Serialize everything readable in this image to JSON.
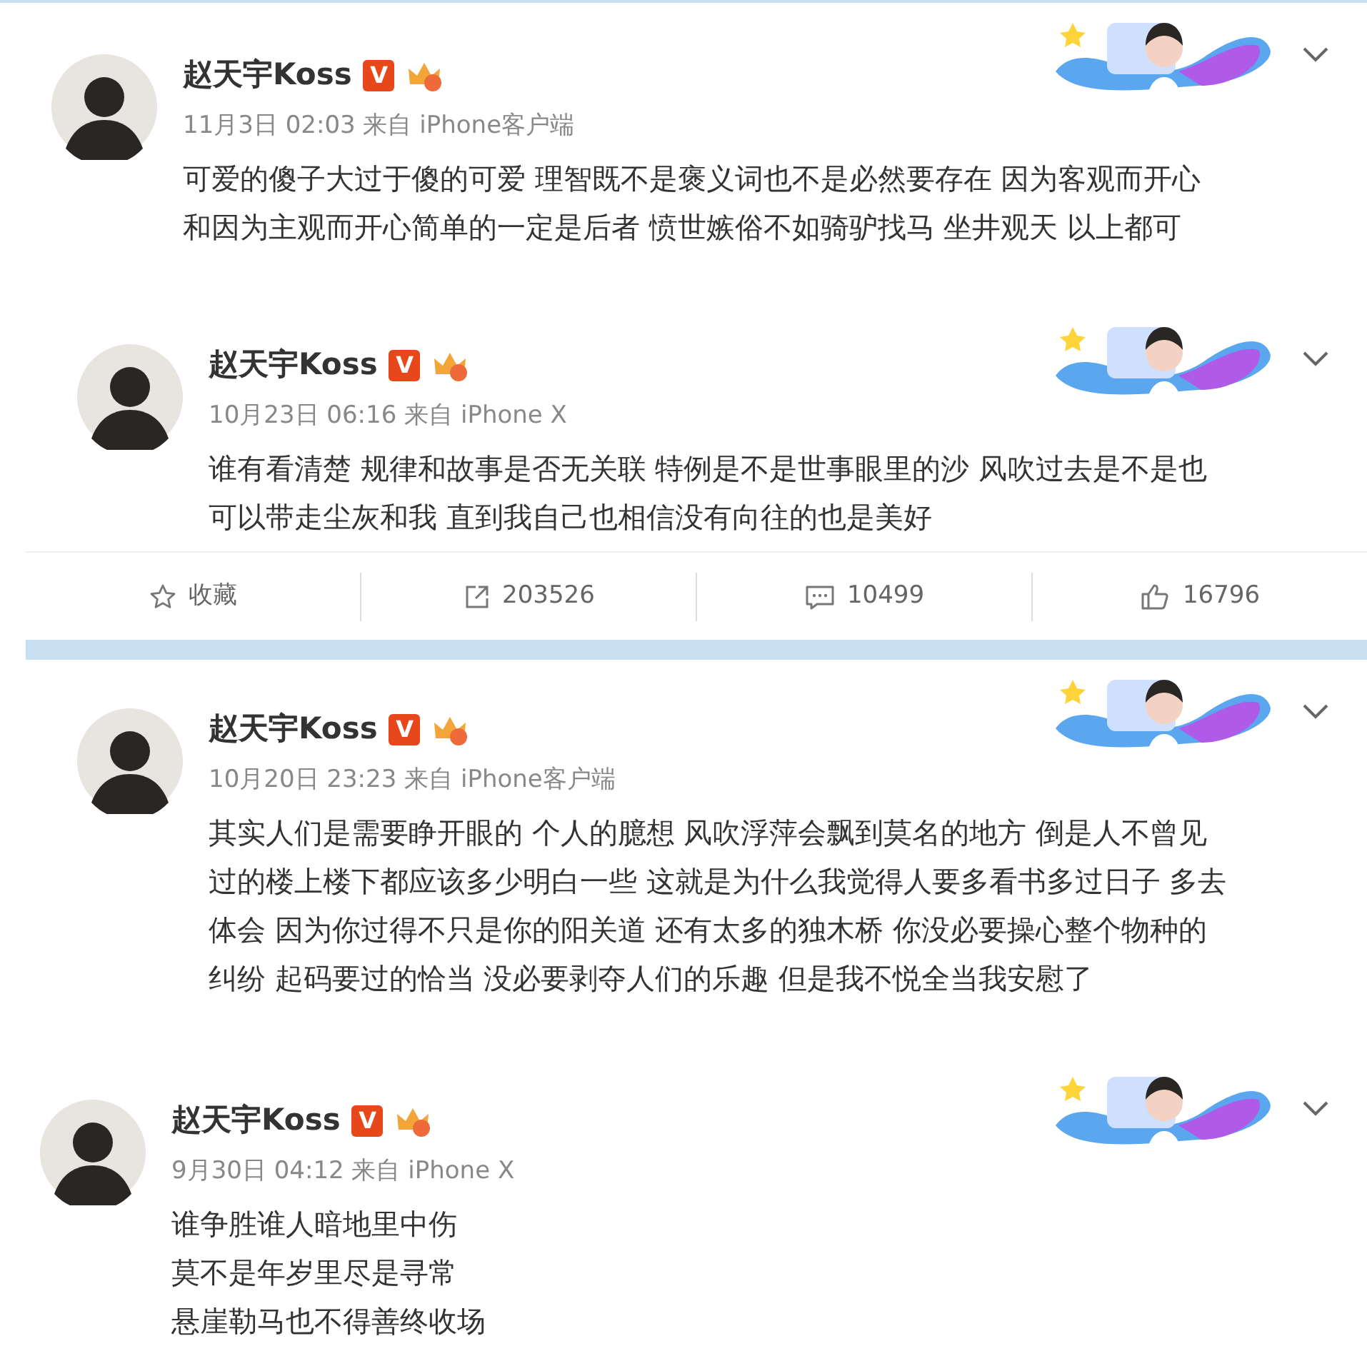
{
  "posts": [
    {
      "author": "赵天宇Koss",
      "verified_mark": "V",
      "meta": "11月3日 02:03 来自 iPhone客户端",
      "lines": [
        "可爱的傻子大过于傻的可爱 理智既不是褒义词也不是必然要存在 因为客观而开心",
        "和因为主观而开心简单的一定是后者 愤世嫉俗不如骑驴找马 坐井观天 以上都可"
      ]
    },
    {
      "author": "赵天宇Koss",
      "verified_mark": "V",
      "meta": "10月23日 06:16 来自 iPhone X",
      "lines": [
        "谁有看清楚 规律和故事是否无关联 特例是不是世事眼里的沙 风吹过去是不是也",
        "可以带走尘灰和我 直到我自己也相信没有向往的也是美好"
      ],
      "actions": [
        {
          "kind": "favorite",
          "label": "收藏"
        },
        {
          "kind": "repost",
          "label": "203526"
        },
        {
          "kind": "comment",
          "label": "10499"
        },
        {
          "kind": "like",
          "label": "16796"
        }
      ]
    },
    {
      "author": "赵天宇Koss",
      "verified_mark": "V",
      "meta": "10月20日 23:23 来自 iPhone客户端",
      "lines": [
        "其实人们是需要睁开眼的 个人的臆想 风吹浮萍会飘到莫名的地方 倒是人不曾见",
        "过的楼上楼下都应该多少明白一些 这就是为什么我觉得人要多看书多过日子 多去",
        "体会 因为你过得不只是你的阳关道 还有太多的独木桥 你没必要操心整个物种的",
        "纠纷 起码要过的恰当 没必要剥夺人们的乐趣 但是我不悦全当我安慰了"
      ]
    },
    {
      "author": "赵天宇Koss",
      "verified_mark": "V",
      "meta": "9月30日 04:12 来自 iPhone X",
      "lines": [
        "谁争胜谁人暗地里中伤",
        "莫不是年岁里尽是寻常",
        "悬崖勒马也不得善终收场"
      ]
    }
  ]
}
